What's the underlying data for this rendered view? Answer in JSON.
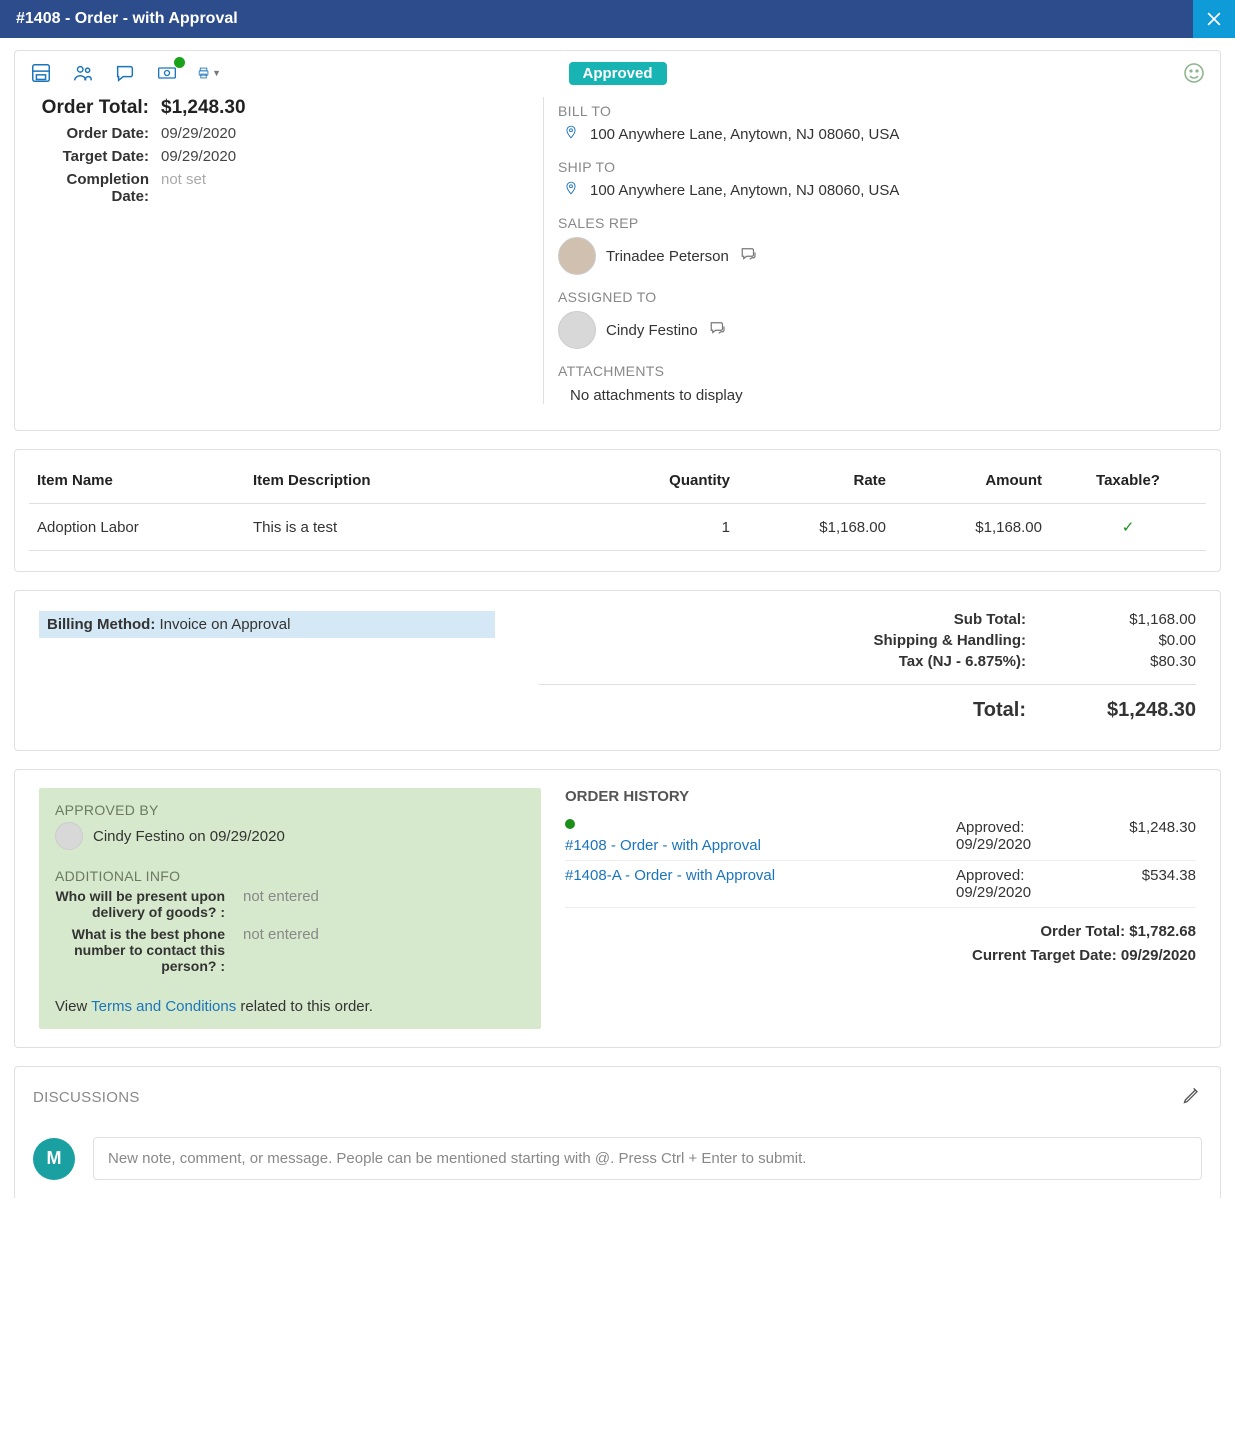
{
  "header": {
    "title": "#1408 - Order - with Approval",
    "close_icon": "close"
  },
  "toolbar": {
    "status": "Approved",
    "icons": [
      "save",
      "people",
      "chat",
      "cash",
      "print"
    ]
  },
  "order": {
    "total_label": "Order Total:",
    "total_value": "$1,248.30",
    "rows": [
      {
        "label": "Order Date:",
        "value": "09/29/2020"
      },
      {
        "label": "Target Date:",
        "value": "09/29/2020"
      },
      {
        "label": "Completion Date:",
        "value": "not set",
        "muted": true
      }
    ]
  },
  "bill_to": {
    "header": "BILL TO",
    "address": "100 Anywhere Lane, Anytown, NJ 08060, USA"
  },
  "ship_to": {
    "header": "SHIP TO",
    "address": "100 Anywhere Lane, Anytown, NJ 08060, USA"
  },
  "sales_rep": {
    "header": "SALES REP",
    "name": "Trinadee Peterson"
  },
  "assigned_to": {
    "header": "ASSIGNED TO",
    "name": "Cindy Festino"
  },
  "attachments": {
    "header": "ATTACHMENTS",
    "empty": "No attachments to display"
  },
  "items": {
    "headers": {
      "name": "Item Name",
      "desc": "Item Description",
      "qty": "Quantity",
      "rate": "Rate",
      "amount": "Amount",
      "tax": "Taxable?"
    },
    "rows": [
      {
        "name": "Adoption Labor",
        "desc": "This is a test",
        "qty": "1",
        "rate": "$1,168.00",
        "amount": "$1,168.00",
        "tax": true
      }
    ]
  },
  "billing": {
    "label": "Billing Method:",
    "value": "Invoice on Approval"
  },
  "totals": {
    "lines": [
      {
        "label": "Sub Total:",
        "value": "$1,168.00"
      },
      {
        "label": "Shipping & Handling:",
        "value": "$0.00"
      },
      {
        "label": "Tax (NJ - 6.875%):",
        "value": "$80.30"
      }
    ],
    "grand_label": "Total:",
    "grand_value": "$1,248.30"
  },
  "approval": {
    "approved_header": "APPROVED BY",
    "approved_by": "Cindy Festino on 09/29/2020",
    "addl_header": "ADDITIONAL INFO",
    "questions": [
      {
        "q": "Who will be present upon delivery of goods? :",
        "a": "not entered"
      },
      {
        "q": "What is the best phone number to contact this person? :",
        "a": "not entered"
      }
    ],
    "tc_pre": "View ",
    "tc_link": "Terms and Conditions",
    "tc_post": " related to this order."
  },
  "history": {
    "header": "ORDER HISTORY",
    "rows": [
      {
        "dot": true,
        "link": "#1408 - Order - with Approval",
        "status": "Approved:",
        "date": "09/29/2020",
        "amt": "$1,248.30"
      },
      {
        "dot": false,
        "link": "#1408-A - Order - with Approval",
        "status": "Approved:",
        "date": "09/29/2020",
        "amt": "$534.38"
      }
    ],
    "footer_total_label": "Order Total: ",
    "footer_total_value": "$1,782.68",
    "footer_target_label": "Current Target Date: ",
    "footer_target_value": "09/29/2020"
  },
  "discussions": {
    "header": "DISCUSSIONS",
    "avatar_letter": "M",
    "placeholder": "New note, comment, or message. People can be mentioned starting with @. Press Ctrl + Enter to submit."
  }
}
